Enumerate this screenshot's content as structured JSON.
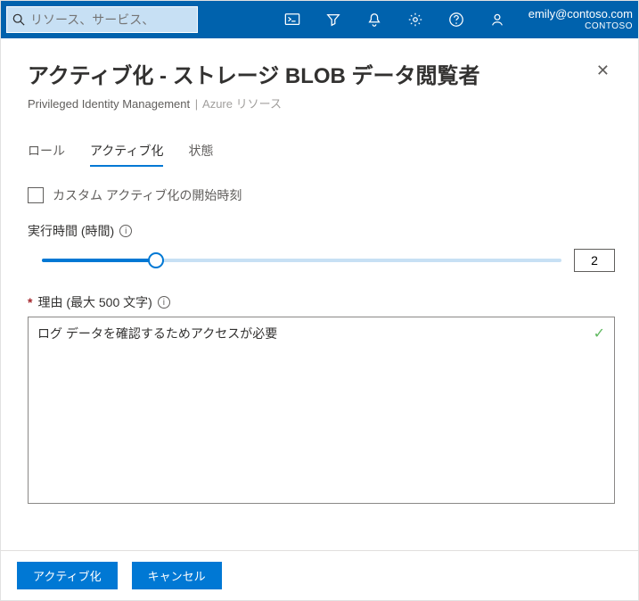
{
  "topbar": {
    "search_placeholder": "リソース、サービス、",
    "account_email": "emily@contoso.com",
    "account_org": "CONTOSO"
  },
  "page": {
    "title": "アクティブ化 - ストレージ BLOB データ閲覧者",
    "breadcrumb_part1": "Privileged Identity Management",
    "breadcrumb_part2": "Azure リソース"
  },
  "tabs": {
    "roles": "ロール",
    "activate": "アクティブ化",
    "status": "状態"
  },
  "fields": {
    "custom_start_label": "カスタム アクティブ化の開始時刻",
    "duration_label": "実行時間 (時間)",
    "duration_value": "2",
    "duration_fill_pct": 22,
    "reason_label": "理由 (最大 500 文字)",
    "reason_value": "ログ データを確認するためアクセスが必要"
  },
  "buttons": {
    "activate": "アクティブ化",
    "cancel": "キャンセル"
  }
}
